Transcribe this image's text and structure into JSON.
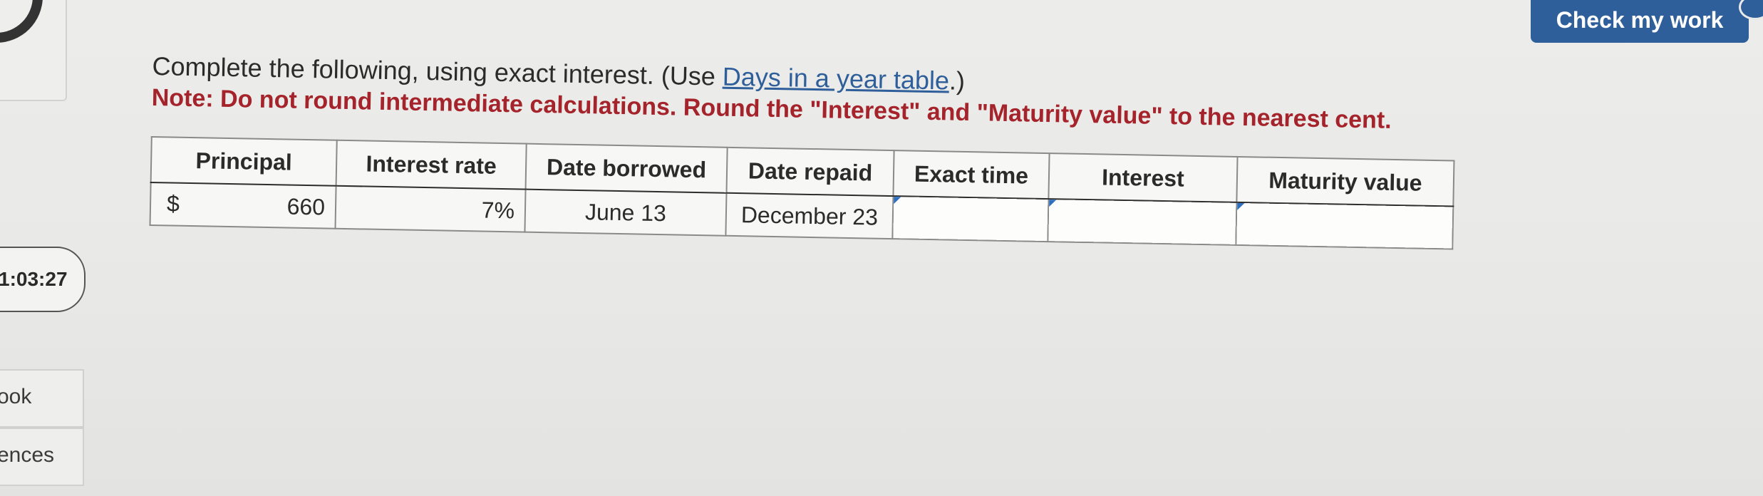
{
  "header": {
    "check_button_label": "Check my work"
  },
  "sidebar": {
    "timer": "1:03:27",
    "items": [
      {
        "label": "ook"
      },
      {
        "label": "ences"
      }
    ]
  },
  "instructions": {
    "text_before_link": "Complete the following, using exact interest. (Use ",
    "link_text": "Days in a year table",
    "text_after_link": ".)",
    "note": "Note: Do not round intermediate calculations. Round the \"Interest\" and \"Maturity value\" to the nearest cent."
  },
  "table": {
    "headers": [
      "Principal",
      "Interest rate",
      "Date borrowed",
      "Date repaid",
      "Exact time",
      "Interest",
      "Maturity value"
    ],
    "row": {
      "currency_symbol": "$",
      "principal": "660",
      "interest_rate": "7%",
      "date_borrowed": "June 13",
      "date_repaid": "December 23",
      "exact_time": "",
      "interest": "",
      "maturity_value": ""
    }
  },
  "colors": {
    "accent": "#2f5f9a",
    "note_red": "#a5232b"
  }
}
